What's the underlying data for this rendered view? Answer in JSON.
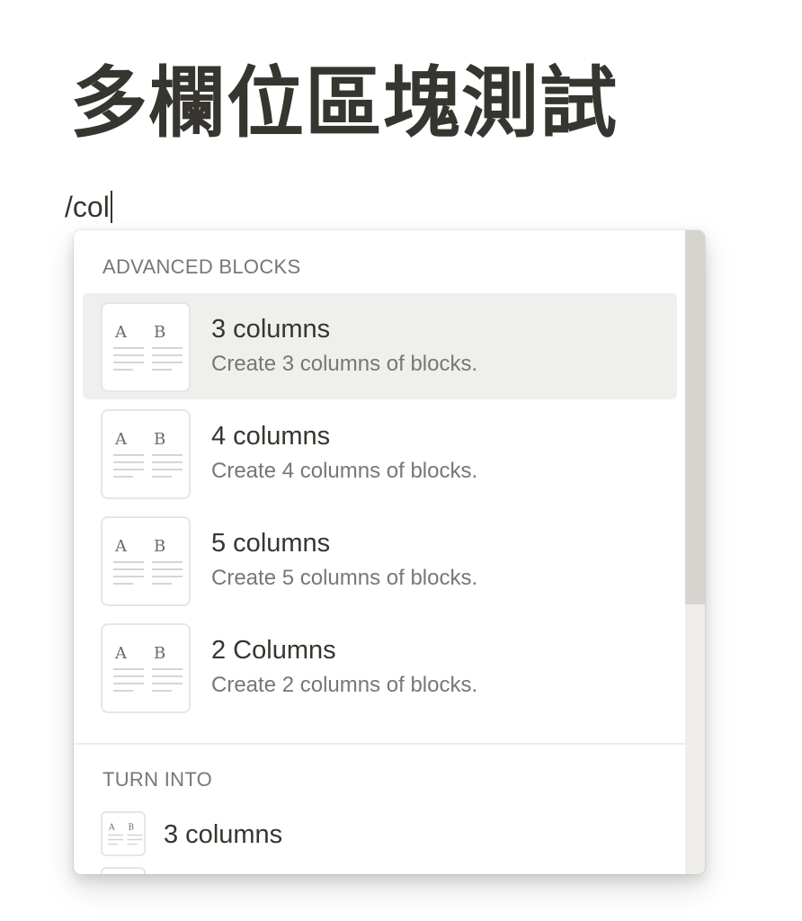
{
  "page": {
    "title": "多欄位區塊測試",
    "editor_text": "/col"
  },
  "menu": {
    "sections": [
      {
        "header": "ADVANCED BLOCKS",
        "items": [
          {
            "title": "3 columns",
            "description": "Create 3 columns of blocks.",
            "thumb_letters": [
              "A",
              "B"
            ],
            "selected": true
          },
          {
            "title": "4 columns",
            "description": "Create 4 columns of blocks.",
            "thumb_letters": [
              "A",
              "B"
            ],
            "selected": false
          },
          {
            "title": "5 columns",
            "description": "Create 5 columns of blocks.",
            "thumb_letters": [
              "A",
              "B"
            ],
            "selected": false
          },
          {
            "title": "2 Columns",
            "description": "Create 2 columns of blocks.",
            "thumb_letters": [
              "A",
              "B"
            ],
            "selected": false
          }
        ]
      },
      {
        "header": "TURN INTO",
        "items": [
          {
            "title": "3 columns",
            "thumb_letters": [
              "A",
              "B"
            ]
          }
        ]
      }
    ],
    "icon": "columns-preview-icon"
  },
  "colors": {
    "text": "#37352f",
    "secondary_text": "#787774",
    "selected_bg": "#efefee",
    "scrollbar_thumb": "#d5d4cf",
    "scrollbar_track": "#efeeeb"
  }
}
